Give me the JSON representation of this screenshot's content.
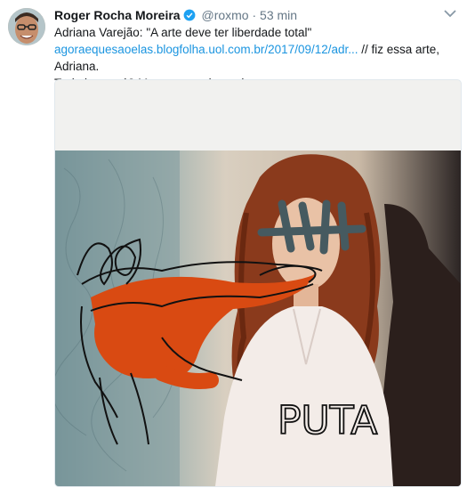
{
  "tweet": {
    "author_name": "Roger Rocha Moreira",
    "handle": "@roxmo",
    "separator": "·",
    "time": "53 min",
    "line1": "Adriana Varejão: \"A arte deve ter liberdade total\"",
    "link": "agoraequesaoelas.blogfolha.uol.com.br/2017/09/12/adr...",
    "line2_rest": " // fiz essa arte, Adriana.",
    "line3": "Tudo bem, né? Mostra pra criançada."
  },
  "media": {
    "scrawled_text": "PUTA"
  },
  "icons": {
    "verified": "verified-badge-icon",
    "caret": "chevron-down-icon"
  },
  "colors": {
    "link": "#1b95e0",
    "verified": "#1da1f2",
    "muted": "#657786",
    "orange_scribble": "#d94a12"
  }
}
